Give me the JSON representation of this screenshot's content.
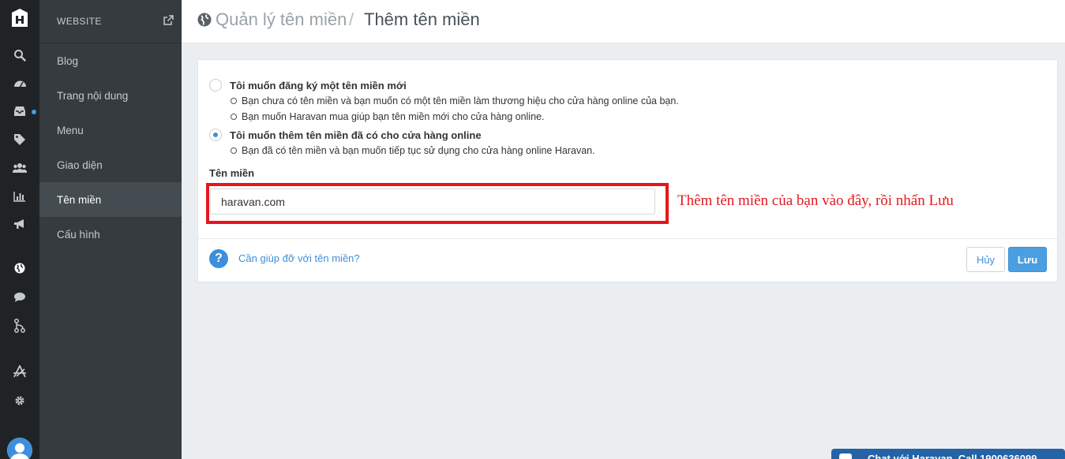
{
  "rail": {
    "icons": [
      "logo-icon",
      "search-icon",
      "dashboard-icon",
      "inbox-icon",
      "tags-icon",
      "users-icon",
      "bar-chart-icon",
      "megaphone-icon",
      "globe-icon",
      "chat-bubble-icon",
      "branch-icon",
      "apps-icon",
      "gear-icon",
      "avatar"
    ],
    "notification_color": "#3ba0e6"
  },
  "subnav": {
    "header": "WEBSITE",
    "items": [
      {
        "label": "Blog",
        "active": false
      },
      {
        "label": "Trang nội dung",
        "active": false
      },
      {
        "label": "Menu",
        "active": false
      },
      {
        "label": "Giao diện",
        "active": false
      },
      {
        "label": "Tên miền",
        "active": true
      },
      {
        "label": "Cấu hình",
        "active": false
      }
    ]
  },
  "header": {
    "breadcrumb_parent": "Quản lý tên miền",
    "separator": "/",
    "breadcrumb_current": "Thêm tên miền"
  },
  "form": {
    "option1": {
      "title": "Tôi muốn đăng ký một tên miền mới",
      "checked": false,
      "bullets": [
        "Bạn chưa có tên miền và bạn muốn có một tên miền làm thương hiệu cho cửa hàng online của bạn.",
        "Bạn muốn Haravan mua giúp bạn tên miền mới cho cửa hàng online."
      ]
    },
    "option2": {
      "title": "Tôi muốn thêm tên miền đã có cho cửa hàng online",
      "checked": true,
      "bullets": [
        "Bạn đã có tên miền và bạn muốn tiếp tục sử dụng cho cửa hàng online Haravan."
      ]
    },
    "field_label": "Tên miền",
    "domain_value": "haravan.com",
    "annotation": "Thêm tên miền của bạn vào đây, rồi nhấn Lưu",
    "annotation_color": "#e21a1f",
    "help_link": "Cần giúp đỡ với tên miền?",
    "cancel_label": "Hủy",
    "save_label": "Lưu"
  },
  "chat": {
    "label": "Chat với Haravan. Call 1900636099"
  },
  "colors": {
    "accent": "#3d8fdb",
    "sidebar": "#353b3f",
    "rail": "#1f2326"
  }
}
